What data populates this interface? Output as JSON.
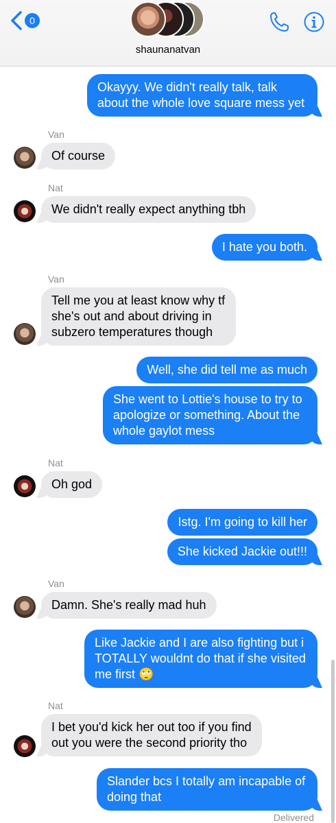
{
  "header": {
    "unread_count": "0",
    "contact_name": "shaunanatvan"
  },
  "messages": [
    {
      "from": "me",
      "text": "Okayyy. We didn't really talk, talk about the whole love square mess yet"
    },
    {
      "sender_label": "Van",
      "text": "Of course"
    },
    {
      "sender_label": "Nat",
      "text": "We didn't really expect anything tbh"
    },
    {
      "from": "me",
      "text": "I hate you both."
    },
    {
      "sender_label": "Van",
      "text": "Tell me you at least know why tf she's out and about driving in subzero temperatures though"
    },
    {
      "from": "me",
      "text": "Well, she did tell me as much"
    },
    {
      "from": "me",
      "text": "She went to Lottie's house to try to apologize or something. About the whole gaylot mess"
    },
    {
      "sender_label": "Nat",
      "text": "Oh god"
    },
    {
      "from": "me",
      "text": "Istg. I'm going to kill her"
    },
    {
      "from": "me",
      "text": "She kicked Jackie out!!!"
    },
    {
      "sender_label": "Van",
      "text": "Damn. She's really mad huh"
    },
    {
      "from": "me",
      "text": "Like Jackie and I are also fighting but i TOTALLY wouldnt do that if she visited me first 🙄"
    },
    {
      "sender_label": "Nat",
      "text": "I bet you'd kick her out too if you find out you were the second priority tho"
    },
    {
      "from": "me",
      "text": "Slander bcs I totally am incapable of doing that"
    }
  ],
  "status": {
    "delivered": "Delivered"
  },
  "colors": {
    "outgoing_bubble": "#1b7ff5",
    "incoming_bubble": "#e9e9eb",
    "accent": "#1a7ef7"
  },
  "icons": [
    "back-chevron-icon",
    "phone-icon",
    "info-icon"
  ]
}
